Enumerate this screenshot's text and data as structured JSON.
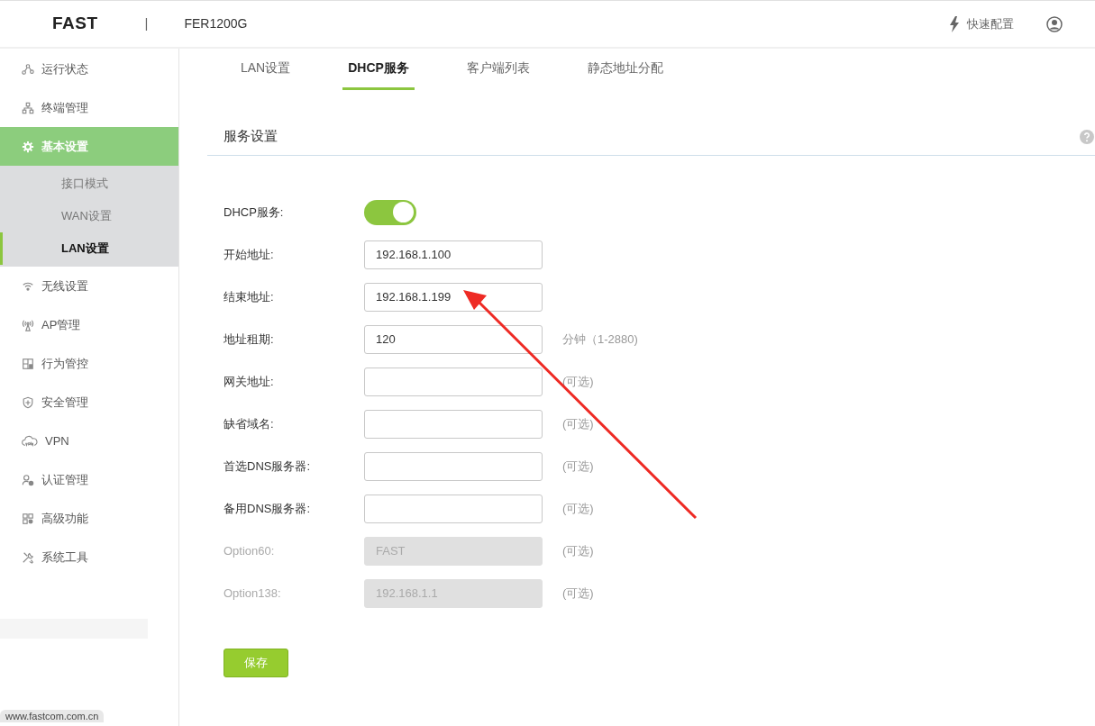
{
  "header": {
    "logo": "FAST",
    "separator": "|",
    "model": "FER1200G",
    "quick_setup": "快速配置"
  },
  "sidebar": {
    "items": [
      {
        "label": "运行状态",
        "selected": false
      },
      {
        "label": "终端管理",
        "selected": false
      },
      {
        "label": "基本设置",
        "selected": true,
        "children": [
          {
            "label": "接口模式",
            "selected": false
          },
          {
            "label": "WAN设置",
            "selected": false
          },
          {
            "label": "LAN设置",
            "selected": true
          }
        ]
      },
      {
        "label": "无线设置",
        "selected": false
      },
      {
        "label": "AP管理",
        "selected": false
      },
      {
        "label": "行为管控",
        "selected": false
      },
      {
        "label": "安全管理",
        "selected": false
      },
      {
        "label": "VPN",
        "selected": false
      },
      {
        "label": "认证管理",
        "selected": false
      },
      {
        "label": "高级功能",
        "selected": false
      },
      {
        "label": "系统工具",
        "selected": false
      }
    ],
    "footer_link": "www.fastcom.com.cn"
  },
  "tabs": [
    {
      "label": "LAN设置",
      "selected": false
    },
    {
      "label": "DHCP服务",
      "selected": true
    },
    {
      "label": "客户端列表",
      "selected": false
    },
    {
      "label": "静态地址分配",
      "selected": false
    }
  ],
  "section": {
    "title": "服务设置"
  },
  "form": [
    {
      "kind": "toggle",
      "label": "DHCP服务:",
      "on": true
    },
    {
      "kind": "text",
      "label": "开始地址:",
      "value": "192.168.1.100",
      "disabled": false
    },
    {
      "kind": "text",
      "label": "结束地址:",
      "value": "192.168.1.199",
      "disabled": false
    },
    {
      "kind": "text",
      "label": "地址租期:",
      "value": "120",
      "suffix": "分钟（1-2880)",
      "disabled": false
    },
    {
      "kind": "text",
      "label": "网关地址:",
      "suffix": "(可选)",
      "disabled": false
    },
    {
      "kind": "text",
      "label": "缺省域名:",
      "suffix": "(可选)",
      "disabled": false
    },
    {
      "kind": "text",
      "label": "首选DNS服务器:",
      "suffix": "(可选)",
      "disabled": false
    },
    {
      "kind": "text",
      "label": "备用DNS服务器:",
      "suffix": "(可选)",
      "disabled": false
    },
    {
      "kind": "text",
      "label": "Option60:",
      "value": "FAST",
      "suffix": "(可选)",
      "disabled": true
    },
    {
      "kind": "text",
      "label": "Option138:",
      "value": "192.168.1.1",
      "suffix": "(可选)",
      "disabled": true
    }
  ],
  "save_button": "保存"
}
